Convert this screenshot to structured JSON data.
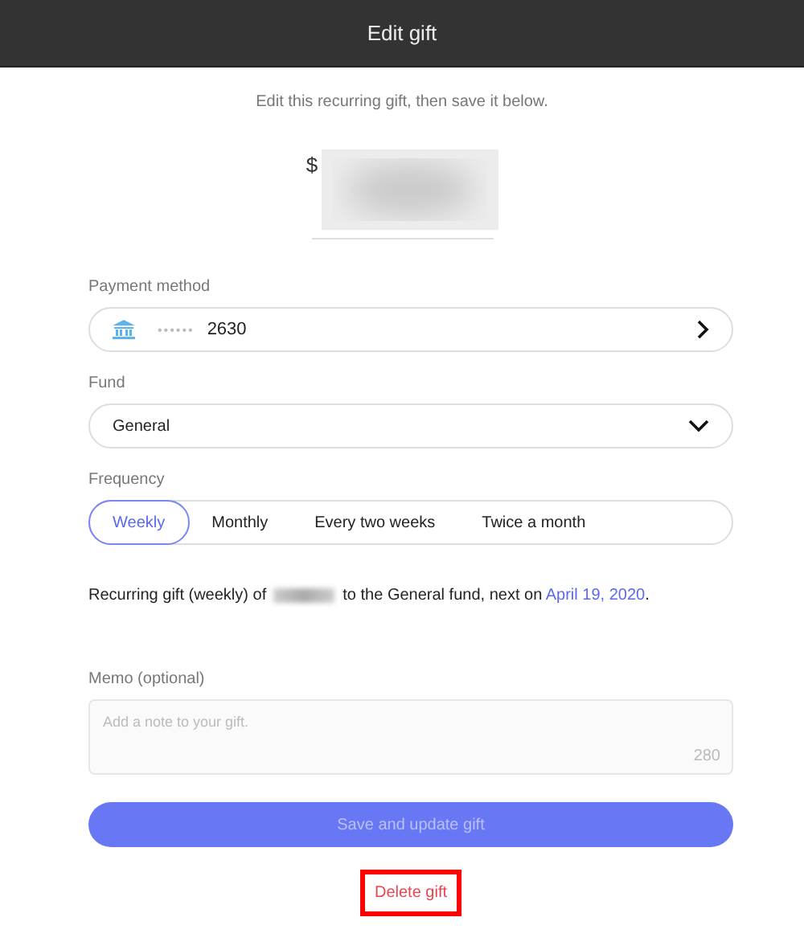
{
  "header": {
    "title": "Edit gift"
  },
  "subtitle": "Edit this recurring gift, then save it below.",
  "amount": {
    "currency": "$",
    "redacted": true
  },
  "payment_method": {
    "label": "Payment method",
    "mask": "••••••",
    "last4": "2630"
  },
  "fund": {
    "label": "Fund",
    "value": "General"
  },
  "frequency": {
    "label": "Frequency",
    "options": [
      {
        "label": "Weekly",
        "selected": true
      },
      {
        "label": "Monthly",
        "selected": false
      },
      {
        "label": "Every two weeks",
        "selected": false
      },
      {
        "label": "Twice a month",
        "selected": false
      }
    ]
  },
  "summary": {
    "before": "Recurring gift (weekly) of",
    "after": "to the General fund, next on",
    "date": "April 19, 2020",
    "end": "."
  },
  "memo": {
    "label": "Memo (optional)",
    "placeholder": "Add a note to your gift.",
    "counter": "280"
  },
  "save_button": {
    "label": "Save and update gift",
    "disabled": true
  },
  "delete_button": {
    "label": "Delete gift",
    "highlighted": true
  }
}
